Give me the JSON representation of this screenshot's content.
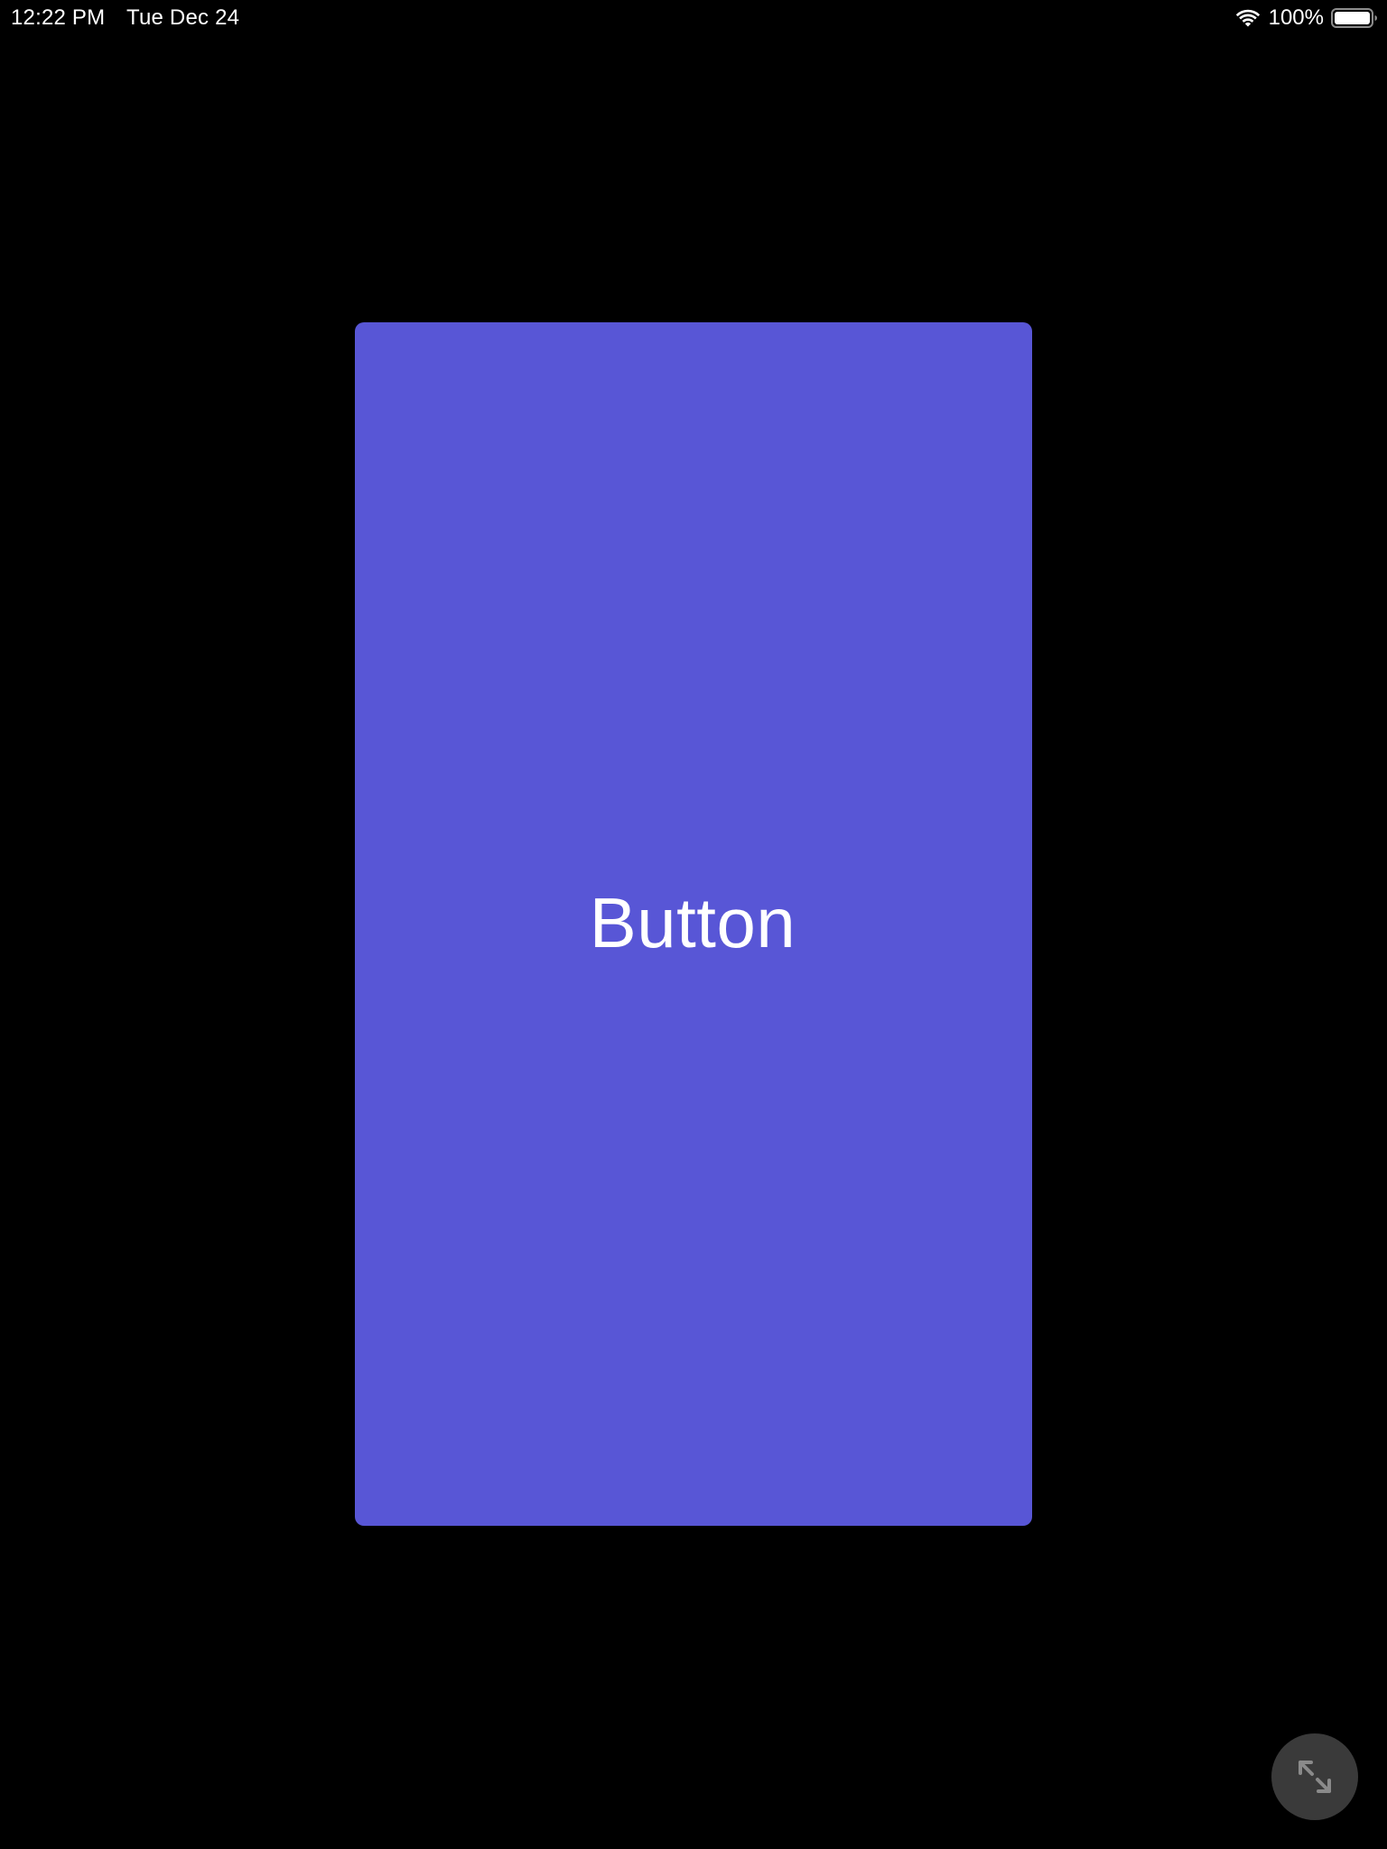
{
  "status_bar": {
    "time": "12:22 PM",
    "date": "Tue Dec 24",
    "battery_percent": "100%",
    "wifi_icon": "wifi-icon",
    "battery_icon": "battery-full-icon"
  },
  "main": {
    "button_label": "Button",
    "button_color": "#5856d6",
    "background_color": "#000000"
  },
  "controls": {
    "expand_icon": "expand-arrows-icon",
    "expand_button_color": "#3a3a3a"
  }
}
